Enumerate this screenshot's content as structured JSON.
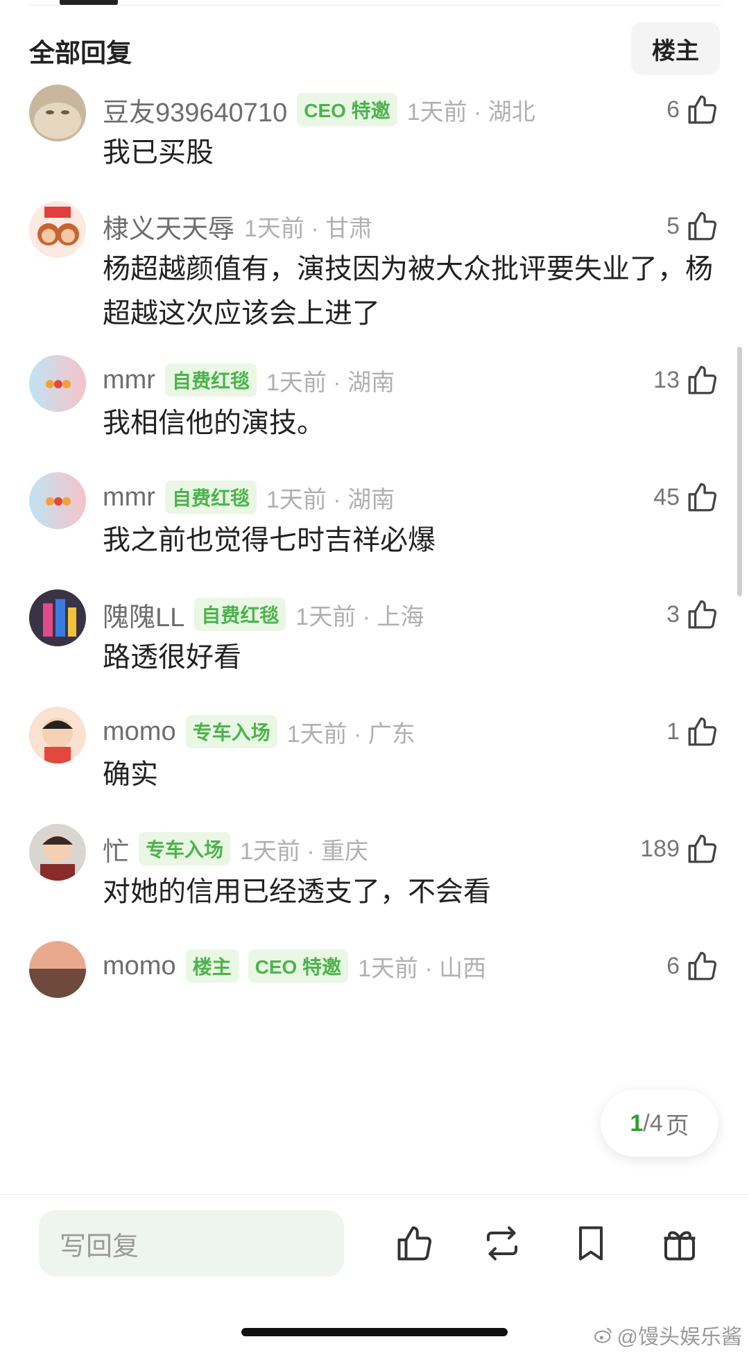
{
  "header": {
    "title": "全部回复",
    "owner_filter": "楼主"
  },
  "comments": [
    {
      "username": "豆友939640710",
      "badges": [
        "CEO 特邀"
      ],
      "time": "1天前 · 湖北",
      "likes": "6",
      "text": "我已买股"
    },
    {
      "username": "棣义天天辱",
      "badges": [],
      "time": "1天前 · 甘肃",
      "likes": "5",
      "text": "杨超越颜值有，演技因为被大众批评要失业了，杨超越这次应该会上进了"
    },
    {
      "username": "mmr",
      "badges": [
        "自费红毯"
      ],
      "time": "1天前 · 湖南",
      "likes": "13",
      "text": "我相信他的演技。"
    },
    {
      "username": "mmr",
      "badges": [
        "自费红毯"
      ],
      "time": "1天前 · 湖南",
      "likes": "45",
      "text": "我之前也觉得七时吉祥必爆"
    },
    {
      "username": "隗隗LL",
      "badges": [
        "自费红毯"
      ],
      "time": "1天前 · 上海",
      "likes": "3",
      "text": "路透很好看"
    },
    {
      "username": "momo",
      "badges": [
        "专车入场"
      ],
      "time": "1天前 · 广东",
      "likes": "1",
      "text": "确实"
    },
    {
      "username": "忙",
      "badges": [
        "专车入场"
      ],
      "time": "1天前 · 重庆",
      "likes": "189",
      "text": "对她的信用已经透支了，不会看"
    },
    {
      "username": "momo",
      "badges": [
        "楼主",
        "CEO 特邀"
      ],
      "time": "1天前 · 山西",
      "likes": "6",
      "text": ""
    }
  ],
  "pagination": {
    "current": "1",
    "total": "/4",
    "unit": "页"
  },
  "bottom_bar": {
    "reply_placeholder": "写回复"
  },
  "watermark": "@馒头娱乐酱",
  "colors": {
    "badge_green": "#4cb34c",
    "accent_green": "#2e9c37"
  }
}
